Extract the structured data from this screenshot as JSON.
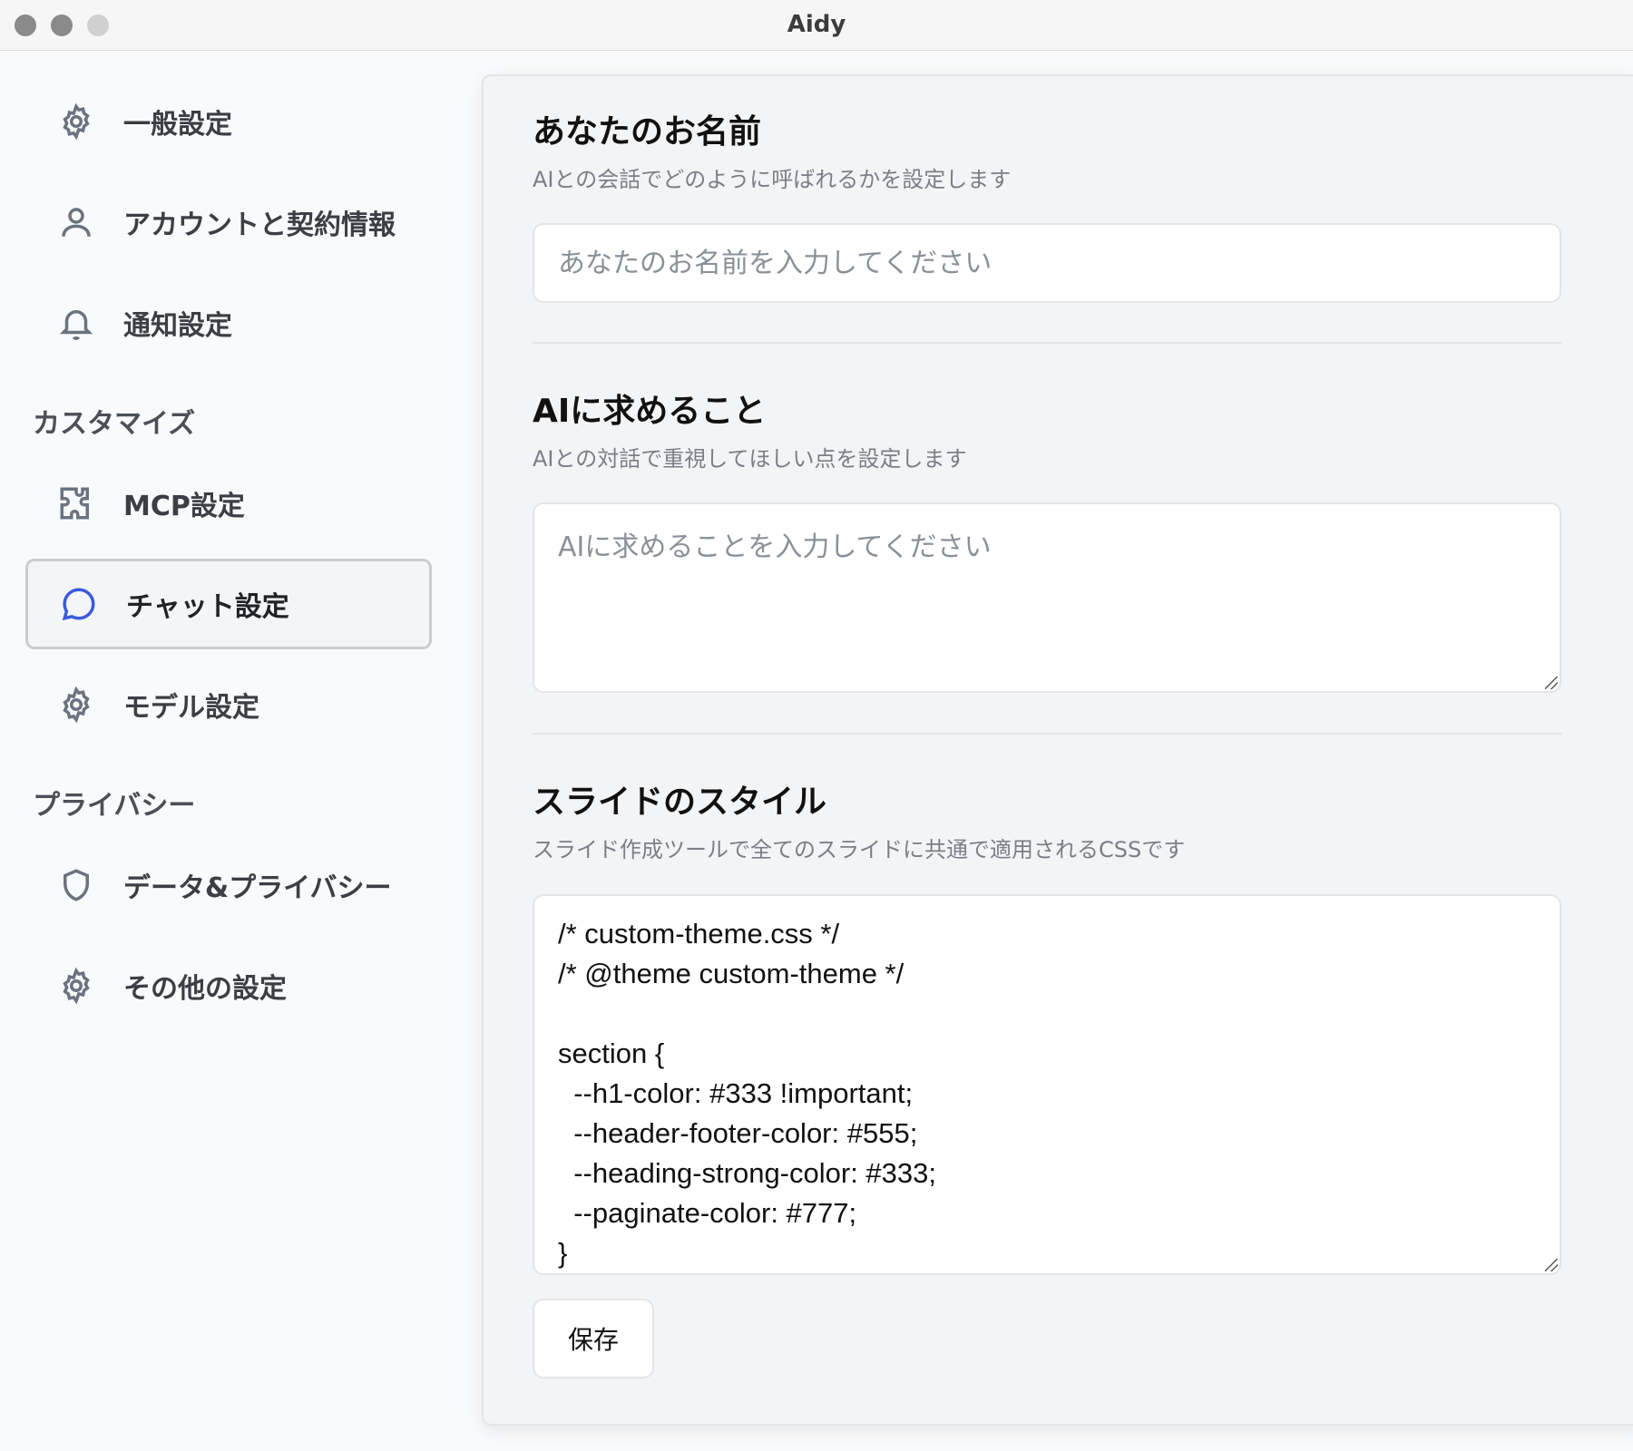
{
  "window": {
    "title": "Aidy"
  },
  "sidebar": {
    "items": [
      {
        "label": "一般設定",
        "icon": "gear-icon"
      },
      {
        "label": "アカウントと契約情報",
        "icon": "user-icon"
      },
      {
        "label": "通知設定",
        "icon": "bell-icon"
      },
      {
        "label": "MCP設定",
        "icon": "puzzle-icon"
      },
      {
        "label": "チャット設定",
        "icon": "chat-bubble-icon",
        "active": true
      },
      {
        "label": "モデル設定",
        "icon": "gear-icon"
      },
      {
        "label": "データ&プライバシー",
        "icon": "shield-icon"
      },
      {
        "label": "その他の設定",
        "icon": "gear-icon"
      }
    ],
    "section_customize": "カスタマイズ",
    "section_privacy": "プライバシー"
  },
  "main": {
    "name_section": {
      "title": "あなたのお名前",
      "description": "AIとの会話でどのように呼ばれるかを設定します",
      "placeholder": "あなたのお名前を入力してください",
      "value": ""
    },
    "ai_section": {
      "title": "AIに求めること",
      "description": "AIとの対話で重視してほしい点を設定します",
      "placeholder": "AIに求めることを入力してください",
      "value": ""
    },
    "slide_section": {
      "title": "スライドのスタイル",
      "description": "スライド作成ツールで全てのスライドに共通で適用されるCSSです",
      "css_value": "/* custom-theme.css */\n/* @theme custom-theme */\n\nsection {\n  --h1-color: #333 !important;\n  --header-footer-color: #555;\n  --heading-strong-color: #333;\n  --paginate-color: #777;\n}"
    },
    "save_label": "保存"
  },
  "colors": {
    "accent": "#3b5bdb",
    "sidebar_text": "#3b3f45",
    "icon_gray": "#6b7280"
  }
}
